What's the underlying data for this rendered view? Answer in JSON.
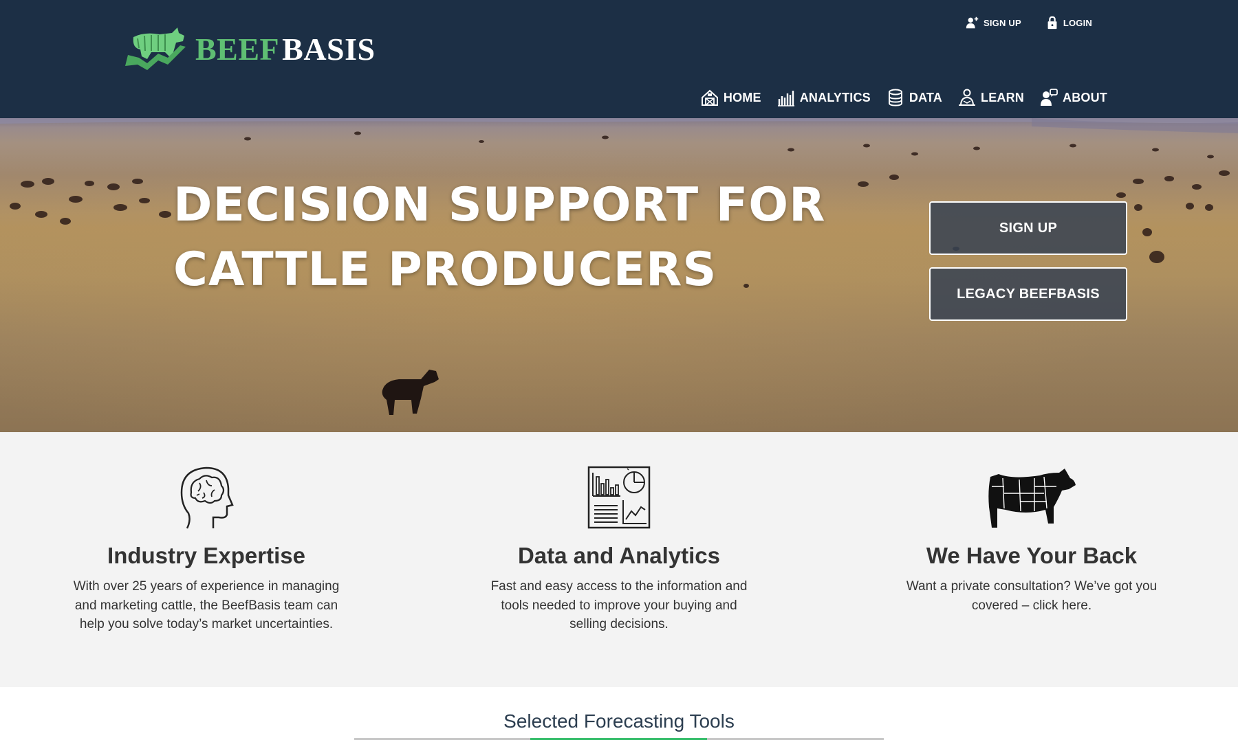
{
  "brand": {
    "part1": "BEEF",
    "part2": "BASIS"
  },
  "util_nav": {
    "signup": "SIGN UP",
    "login": "LOGIN"
  },
  "main_nav": [
    {
      "label": "HOME",
      "icon": "barn-icon"
    },
    {
      "label": "ANALYTICS",
      "icon": "bar-chart-icon"
    },
    {
      "label": "DATA",
      "icon": "database-icon"
    },
    {
      "label": "LEARN",
      "icon": "teacher-icon"
    },
    {
      "label": "ABOUT",
      "icon": "user-chat-icon"
    }
  ],
  "hero": {
    "title_line1": "DECISION SUPPORT FOR",
    "title_line2": "CATTLE PRODUCERS",
    "signup_button": "SIGN UP",
    "legacy_button": "LEGACY BEEFBASIS"
  },
  "features": [
    {
      "title": "Industry Expertise",
      "text": "With over 25 years of experience in managing and marketing cattle, the BeefBasis team can help you solve today’s market uncertainties.",
      "icon": "brain-head-icon"
    },
    {
      "title": "Data and Analytics",
      "text": "Fast and easy access to the information and tools needed to improve your buying and selling decisions.",
      "icon": "dashboard-report-icon"
    },
    {
      "title": "We Have Your Back",
      "text": "Want a private consultation? We’ve got you covered – click here.",
      "icon": "cow-cuts-icon"
    }
  ],
  "tools": {
    "heading": "Selected Forecasting Tools"
  },
  "colors": {
    "header_bg": "#1c2f45",
    "brand_green": "#5fbf73",
    "accent_green": "#3bbf6e",
    "features_bg": "#f3f3f3"
  }
}
